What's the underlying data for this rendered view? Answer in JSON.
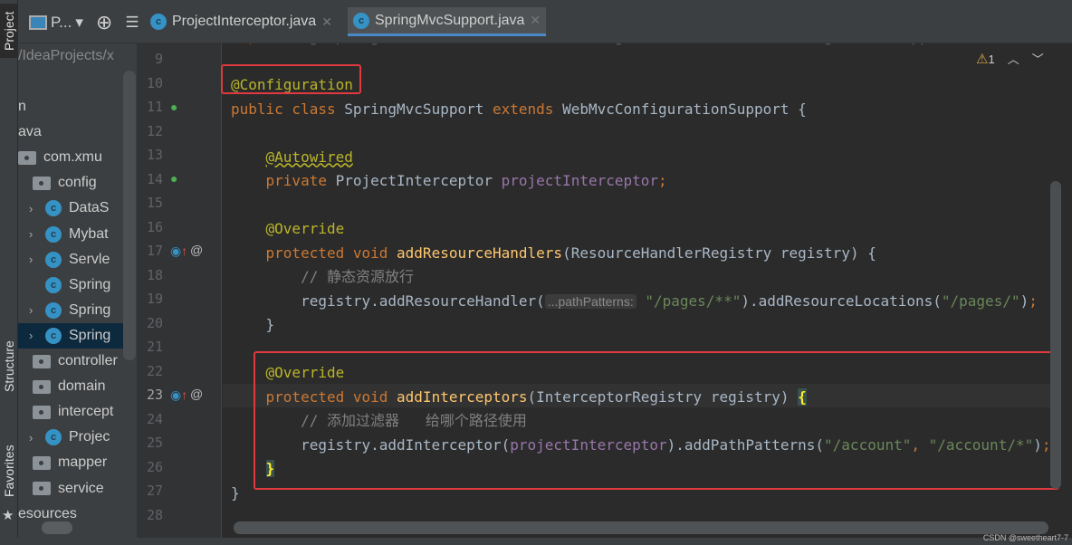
{
  "side_tabs": {
    "project": "Project",
    "structure": "Structure",
    "favorites": "Favorites"
  },
  "toolbar": {
    "project_view": "P...",
    "chevron": "▾"
  },
  "tabs": [
    {
      "label": "ProjectInterceptor.java",
      "active": false
    },
    {
      "label": "SpringMvcSupport.java",
      "active": true
    }
  ],
  "tree": [
    {
      "label": "/IdeaProjects/x",
      "type": "path"
    },
    {
      "label": "n",
      "type": "text"
    },
    {
      "label": "ava",
      "type": "text"
    },
    {
      "label": "com.xmu",
      "type": "folder"
    },
    {
      "label": "config",
      "type": "folder",
      "expanded": true
    },
    {
      "label": "DataS",
      "type": "class",
      "chevron": true
    },
    {
      "label": "Mybat",
      "type": "class",
      "chevron": true
    },
    {
      "label": "Servle",
      "type": "class",
      "chevron": true
    },
    {
      "label": "Spring",
      "type": "class",
      "chevron": false
    },
    {
      "label": "Spring",
      "type": "class",
      "chevron": true
    },
    {
      "label": "Spring",
      "type": "class",
      "chevron": true,
      "selected": true
    },
    {
      "label": "controller",
      "type": "folder"
    },
    {
      "label": "domain",
      "type": "folder"
    },
    {
      "label": "intercept",
      "type": "folder",
      "expanded": true
    },
    {
      "label": "Projec",
      "type": "class",
      "chevron": true
    },
    {
      "label": "mapper",
      "type": "folder"
    },
    {
      "label": "service",
      "type": "folder"
    },
    {
      "label": "esources",
      "type": "text"
    }
  ],
  "inspections": {
    "warnings": "1"
  },
  "line_numbers": [
    "9",
    "10",
    "11",
    "12",
    "13",
    "14",
    "15",
    "16",
    "17",
    "18",
    "19",
    "20",
    "21",
    "22",
    "23",
    "24",
    "25",
    "26",
    "27",
    "28"
  ],
  "code": [
    [
      [
        "kw",
        "import "
      ],
      [
        "tx",
        "org.springframework.web.servlet.config.annotation.WebMvcConfigurationSupport;"
      ]
    ],
    [],
    [
      [
        "an",
        "@Configuration"
      ]
    ],
    [
      [
        "kw",
        "public class "
      ],
      [
        "tx",
        "SpringMvcSupport "
      ],
      [
        "kw",
        "extends "
      ],
      [
        "tx",
        "WebMvcConfigurationSupport {"
      ]
    ],
    [],
    [
      [
        "tx",
        "    "
      ],
      [
        "an ul",
        "@Autowired"
      ]
    ],
    [
      [
        "tx",
        "    "
      ],
      [
        "kw",
        "private "
      ],
      [
        "tx",
        "ProjectInterceptor "
      ],
      [
        "fld",
        "projectInterceptor"
      ],
      [
        "kw",
        ";"
      ]
    ],
    [],
    [
      [
        "tx",
        "    "
      ],
      [
        "an",
        "@Override"
      ]
    ],
    [
      [
        "tx",
        "    "
      ],
      [
        "kw",
        "protected void "
      ],
      [
        "fn",
        "addResourceHandlers"
      ],
      [
        "tx",
        "(ResourceHandlerRegistry registry) {"
      ]
    ],
    [
      [
        "tx",
        "        "
      ],
      [
        "cm",
        "// 静态资源放行"
      ]
    ],
    [
      [
        "tx",
        "        registry.addResourceHandler("
      ],
      [
        "hint",
        "...pathPatterns:"
      ],
      [
        "str",
        " \"/pages/**\""
      ],
      [
        "tx",
        ").addResourceLocations("
      ],
      [
        "str",
        "\"/pages/\""
      ],
      [
        "tx",
        ")"
      ],
      [
        "kw",
        ";"
      ]
    ],
    [
      [
        "tx",
        "    }"
      ]
    ],
    [],
    [
      [
        "tx",
        "    "
      ],
      [
        "an",
        "@Override"
      ]
    ],
    [
      [
        "tx",
        "    "
      ],
      [
        "kw",
        "protected void "
      ],
      [
        "fn",
        "addInterceptors"
      ],
      [
        "tx",
        "(InterceptorRegistry registry) "
      ],
      [
        "brace",
        "{"
      ]
    ],
    [
      [
        "tx",
        "        "
      ],
      [
        "cm",
        "// 添加过滤器   给哪个路径使用"
      ]
    ],
    [
      [
        "tx",
        "        registry.addInterceptor("
      ],
      [
        "fld",
        "projectInterceptor"
      ],
      [
        "tx",
        ").addPathPatterns("
      ],
      [
        "str",
        "\"/account\""
      ],
      [
        "kw",
        ", "
      ],
      [
        "str",
        "\"/account/*\""
      ],
      [
        "tx",
        ")"
      ],
      [
        "kw",
        ";"
      ]
    ],
    [
      [
        "tx",
        "    "
      ],
      [
        "brace",
        "}"
      ]
    ],
    [
      [
        "tx",
        "}"
      ]
    ],
    []
  ],
  "watermark": "CSDN @sweetheart7-7"
}
